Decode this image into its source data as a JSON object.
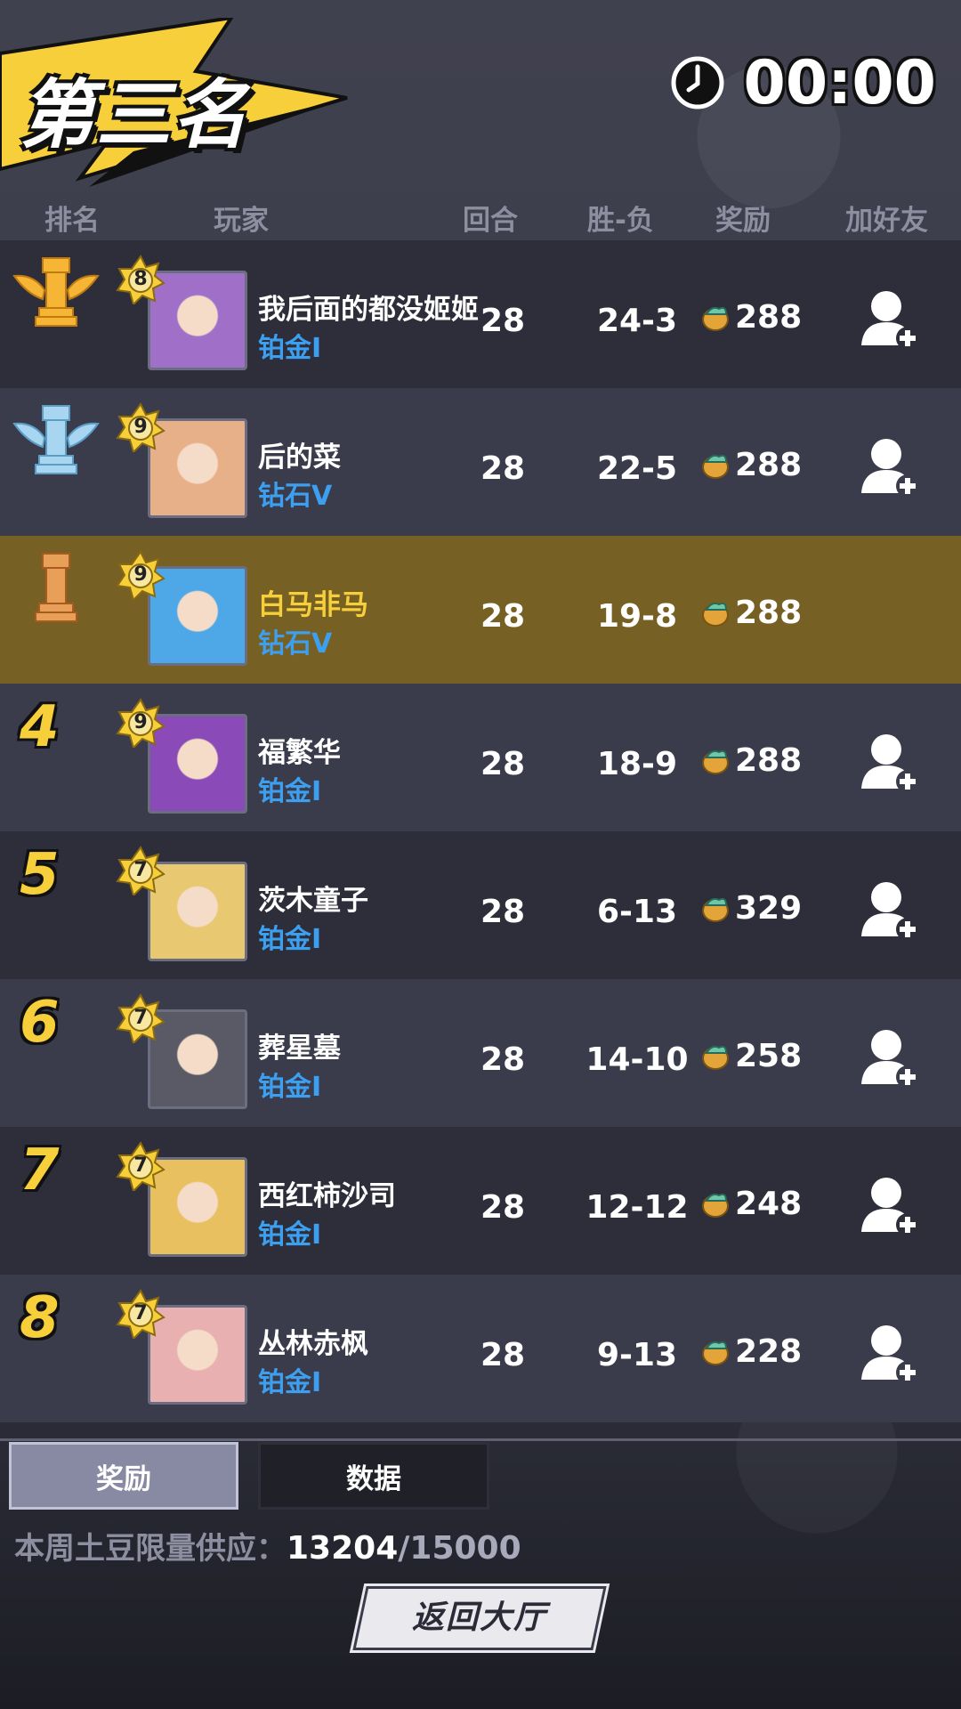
{
  "header": {
    "rank_title": "第三名",
    "timer": "00:00"
  },
  "columns": {
    "rank": "排名",
    "player": "玩家",
    "rounds": "回合",
    "win_loss": "胜-负",
    "reward": "奖励",
    "add_friend": "加好友"
  },
  "players": [
    {
      "rank": "1",
      "rank_icon": "gold-rook-trophy-icon",
      "level": "8",
      "name": "我后面的都没姬姬",
      "tier": "铂金I",
      "rounds": "28",
      "win_loss": "24-3",
      "reward": "288",
      "add_friend": true,
      "avatar_color": "#a070c8"
    },
    {
      "rank": "2",
      "rank_icon": "silver-rook-trophy-icon",
      "level": "9",
      "name": "后的菜",
      "tier": "钻石V",
      "rounds": "28",
      "win_loss": "22-5",
      "reward": "288",
      "add_friend": true,
      "avatar_color": "#e8b088"
    },
    {
      "rank": "3",
      "rank_icon": "bronze-rook-trophy-icon",
      "level": "9",
      "name": "白马非马",
      "tier": "钻石V",
      "rounds": "28",
      "win_loss": "19-8",
      "reward": "288",
      "add_friend": false,
      "avatar_color": "#4ea8e8"
    },
    {
      "rank": "4",
      "rank_icon": "",
      "level": "9",
      "name": "福繁华",
      "tier": "铂金I",
      "rounds": "28",
      "win_loss": "18-9",
      "reward": "288",
      "add_friend": true,
      "avatar_color": "#8a4ab8"
    },
    {
      "rank": "5",
      "rank_icon": "",
      "level": "7",
      "name": "茨木童子",
      "tier": "铂金I",
      "rounds": "28",
      "win_loss": "6-13",
      "reward": "329",
      "add_friend": true,
      "avatar_color": "#e8c870"
    },
    {
      "rank": "6",
      "rank_icon": "",
      "level": "7",
      "name": "葬星墓",
      "tier": "铂金I",
      "rounds": "28",
      "win_loss": "14-10",
      "reward": "258",
      "add_friend": true,
      "avatar_color": "#5a5a66"
    },
    {
      "rank": "7",
      "rank_icon": "",
      "level": "7",
      "name": "西红柿沙司",
      "tier": "铂金I",
      "rounds": "28",
      "win_loss": "12-12",
      "reward": "248",
      "add_friend": true,
      "avatar_color": "#e8c060"
    },
    {
      "rank": "8",
      "rank_icon": "",
      "level": "7",
      "name": "丛林赤枫",
      "tier": "铂金I",
      "rounds": "28",
      "win_loss": "9-13",
      "reward": "228",
      "add_friend": true,
      "avatar_color": "#e8b0b0"
    }
  ],
  "tabs": {
    "rewards": "奖励",
    "data": "数据"
  },
  "supply": {
    "label": "本周土豆限量供应：",
    "current": "13204",
    "total": "/15000"
  },
  "return_button": "返回大厅",
  "colors": {
    "gold": "#f6cf3a",
    "tier_blue": "#3c9ff0",
    "self_highlight": "#776023"
  }
}
